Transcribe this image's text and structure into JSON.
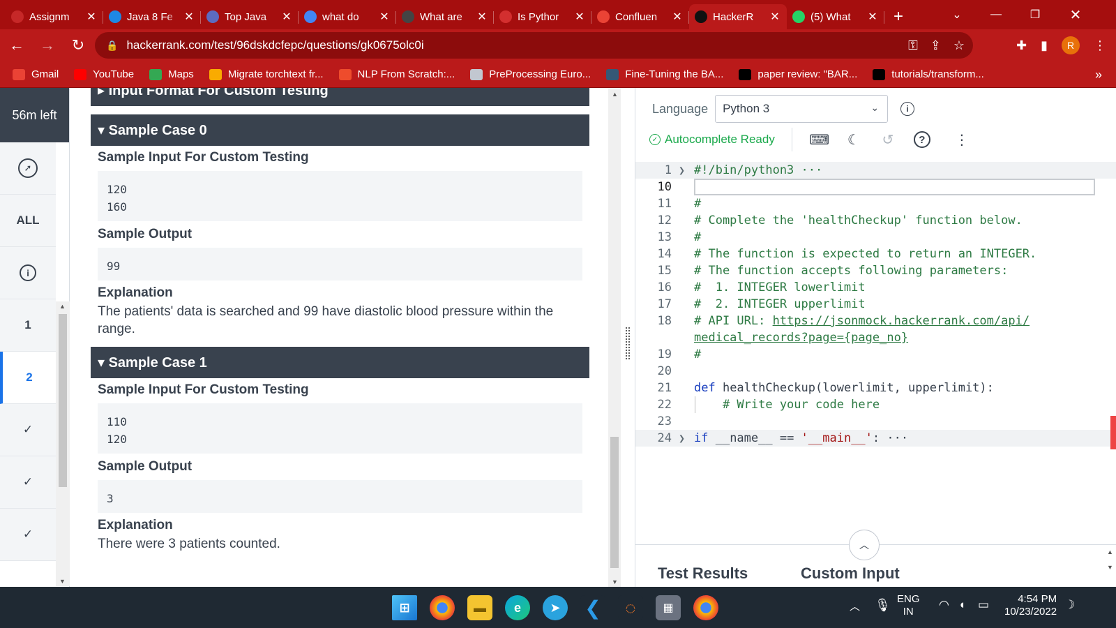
{
  "browser": {
    "tabs": [
      {
        "title": "Assignm",
        "icon": "red-logo-icon",
        "color": "#c62828",
        "active": false
      },
      {
        "title": "Java 8 Fe",
        "icon": "circle-swirl-icon",
        "color": "#1e88e5",
        "active": false
      },
      {
        "title": "Top Java",
        "icon": "ib-logo-icon",
        "color": "#5c6bc0",
        "active": false
      },
      {
        "title": "what do",
        "icon": "google-icon",
        "color": "#4285f4",
        "active": false
      },
      {
        "title": "What are",
        "icon": "openai-icon",
        "color": "#444444",
        "active": false
      },
      {
        "title": "Is Pythor",
        "icon": "n-logo-icon",
        "color": "#d32f2f",
        "active": false
      },
      {
        "title": "Confluen",
        "icon": "gmail-icon",
        "color": "#ea4335",
        "active": false
      },
      {
        "title": "HackerR",
        "icon": "hackerrank-icon",
        "color": "#111111",
        "active": true
      },
      {
        "title": "(5) What",
        "icon": "whatsapp-icon",
        "color": "#25d366",
        "active": false
      }
    ],
    "url": "hackerrank.com/test/96dskdcfepc/questions/gk0675olc0i",
    "profile_initial": "R",
    "bookmarks": [
      {
        "label": "Gmail",
        "icon": "gmail-icon",
        "color": "#ea4335"
      },
      {
        "label": "YouTube",
        "icon": "youtube-icon",
        "color": "#ff0000"
      },
      {
        "label": "Maps",
        "icon": "maps-pin-icon",
        "color": "#34a853"
      },
      {
        "label": "Migrate torchtext fr...",
        "icon": "colab-icon",
        "color": "#f9ab00"
      },
      {
        "label": "NLP From Scratch:...",
        "icon": "pytorch-icon",
        "color": "#ee4c2c"
      },
      {
        "label": "PreProcessing Euro...",
        "icon": "colab-icon",
        "color": "#c2c7d0"
      },
      {
        "label": "Fine-Tuning the BA...",
        "icon": "tds-icon",
        "color": "#355876"
      },
      {
        "label": "paper review: \"BAR...",
        "icon": "medium-icon",
        "color": "#000000"
      },
      {
        "label": "tutorials/transform...",
        "icon": "github-icon",
        "color": "#000000"
      }
    ]
  },
  "sidebar": {
    "time_left": "56m left",
    "all_label": "ALL",
    "questions": [
      "1",
      "2"
    ],
    "check_mark": "✓"
  },
  "problem": {
    "input_format_header": "▸ Input Format For Custom Testing",
    "cases": [
      {
        "header": "▾ Sample Case 0",
        "input_label": "Sample Input For Custom Testing",
        "input_lines": [
          "120",
          "160"
        ],
        "output_label": "Sample Output",
        "output": "99",
        "explanation_label": "Explanation",
        "explanation": "The patients' data is searched and 99 have diastolic blood pressure within the range."
      },
      {
        "header": "▾ Sample Case 1",
        "input_label": "Sample Input For Custom Testing",
        "input_lines": [
          "110",
          "120"
        ],
        "output_label": "Sample Output",
        "output": "3",
        "explanation_label": "Explanation",
        "explanation": "There were 3 patients counted."
      }
    ]
  },
  "editor": {
    "language_label": "Language",
    "language_value": "Python 3",
    "autocomplete": "Autocomplete Ready",
    "code_lines": [
      {
        "num": "1",
        "text": "#!/bin/python3 ···"
      },
      {
        "num": "10",
        "text": ""
      },
      {
        "num": "11",
        "text": "#"
      },
      {
        "num": "12",
        "text": "# Complete the 'healthCheckup' function below."
      },
      {
        "num": "13",
        "text": "#"
      },
      {
        "num": "14",
        "text": "# The function is expected to return an INTEGER."
      },
      {
        "num": "15",
        "text": "# The function accepts following parameters:"
      },
      {
        "num": "16",
        "text": "#  1. INTEGER lowerlimit"
      },
      {
        "num": "17",
        "text": "#  2. INTEGER upperlimit"
      },
      {
        "num": "18",
        "text": "# API URL: ",
        "link": "https://jsonmock.hackerrank.com/api/",
        "link2": "medical_records?page={page_no}"
      },
      {
        "num": "19",
        "text": "#"
      },
      {
        "num": "20",
        "text": ""
      },
      {
        "num": "21",
        "kw": "def",
        "text": " healthCheckup(lowerlimit, upperlimit):"
      },
      {
        "num": "22",
        "text": "    # Write your code here"
      },
      {
        "num": "23",
        "text": ""
      },
      {
        "num": "24",
        "kw": "if",
        "text": " __name__ == ",
        "str": "'__main__'",
        "tail": ": ···"
      }
    ],
    "bottom_tabs": [
      "Test Results",
      "Custom Input"
    ]
  },
  "taskbar": {
    "lang_top": "ENG",
    "lang_bottom": "IN",
    "time": "4:54 PM",
    "date": "10/23/2022"
  }
}
